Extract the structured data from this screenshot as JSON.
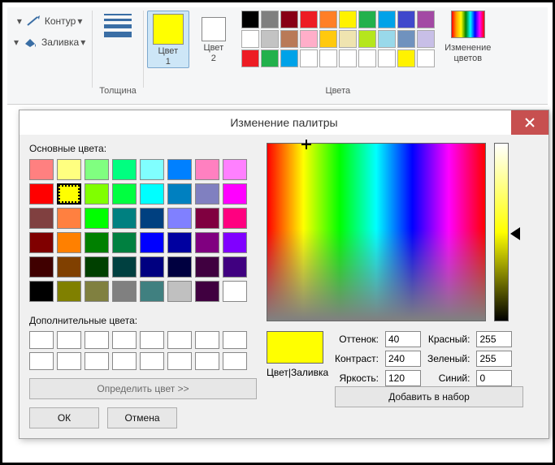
{
  "ribbon": {
    "outline_label": "Контур",
    "fill_label": "Заливка",
    "thickness_label": "Толщина",
    "color1_label": "Цвет\n1",
    "color2_label": "Цвет\n2",
    "colors_group_label": "Цвета",
    "edit_colors_label": "Изменение\nцветов",
    "color1_value": "#ffff00",
    "color2_value": "#ffffff",
    "palette_row1": [
      "#000000",
      "#7f7f7f",
      "#880015",
      "#ed1c24",
      "#ff7f27",
      "#fff200",
      "#22b14c",
      "#00a2e8",
      "#3f48cc",
      "#a349a4"
    ],
    "palette_row2": [
      "#ffffff",
      "#c3c3c3",
      "#b97a57",
      "#ffaec9",
      "#ffc90e",
      "#efe4b0",
      "#b5e61d",
      "#99d9ea",
      "#7092be",
      "#c8bfe7"
    ],
    "palette_row3": [
      "#ed1c24",
      "#22b14c",
      "#00a2e8",
      "#ffffff",
      "#ffffff",
      "#ffffff",
      "#ffffff",
      "#ffffff",
      "#fff200",
      "#ffffff"
    ]
  },
  "dialog": {
    "title": "Изменение палитры",
    "basic_label": "Основные цвета:",
    "custom_label": "Дополнительные цвета:",
    "define_button": "Определить цвет >>",
    "ok_button": "ОК",
    "cancel_button": "Отмена",
    "preview_label": "Цвет|Заливка",
    "hue_label": "Оттенок:",
    "sat_label": "Контраст:",
    "lum_label": "Яркость:",
    "red_label": "Красный:",
    "green_label": "Зеленый:",
    "blue_label": "Синий:",
    "add_button": "Добавить в набор",
    "hue_value": "40",
    "sat_value": "240",
    "lum_value": "120",
    "red_value": "255",
    "green_value": "255",
    "blue_value": "0",
    "selected_basic_index": 9,
    "preview_color": "#ffff00",
    "basic_colors": [
      "#ff8080",
      "#ffff80",
      "#80ff80",
      "#00ff80",
      "#80ffff",
      "#0080ff",
      "#ff80c0",
      "#ff80ff",
      "#ff0000",
      "#ffff00",
      "#80ff00",
      "#00ff40",
      "#00ffff",
      "#0080c0",
      "#8080c0",
      "#ff00ff",
      "#804040",
      "#ff8040",
      "#00ff00",
      "#008080",
      "#004080",
      "#8080ff",
      "#800040",
      "#ff0080",
      "#800000",
      "#ff8000",
      "#008000",
      "#008040",
      "#0000ff",
      "#0000a0",
      "#800080",
      "#8000ff",
      "#400000",
      "#804000",
      "#004000",
      "#004040",
      "#000080",
      "#000040",
      "#400040",
      "#400080",
      "#000000",
      "#808000",
      "#808040",
      "#808080",
      "#408080",
      "#c0c0c0",
      "#400040",
      "#ffffff"
    ]
  }
}
